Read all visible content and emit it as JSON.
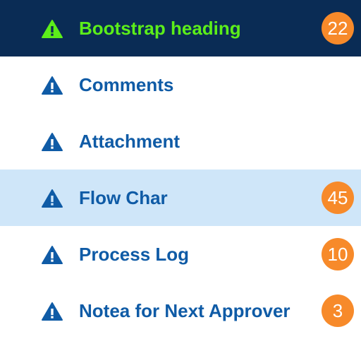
{
  "menu": {
    "items": [
      {
        "label": "Bootstrap heading",
        "badge": "22",
        "icon": "warning-icon",
        "state": "active"
      },
      {
        "label": "Comments",
        "badge": "",
        "icon": "warning-icon",
        "state": "normal"
      },
      {
        "label": "Attachment",
        "badge": "",
        "icon": "warning-icon",
        "state": "normal"
      },
      {
        "label": "Flow Char",
        "badge": "45",
        "icon": "warning-icon",
        "state": "hovered"
      },
      {
        "label": "Process Log",
        "badge": "10",
        "icon": "warning-icon",
        "state": "normal"
      },
      {
        "label": "Notea for Next Approver",
        "badge": "3",
        "icon": "warning-icon",
        "state": "normal"
      }
    ]
  },
  "colors": {
    "active_background": "#0a2c55",
    "active_text": "#5cee1a",
    "hover_background": "#cfe6f9",
    "text": "#0f5ba6",
    "badge": "#f78a2a"
  }
}
